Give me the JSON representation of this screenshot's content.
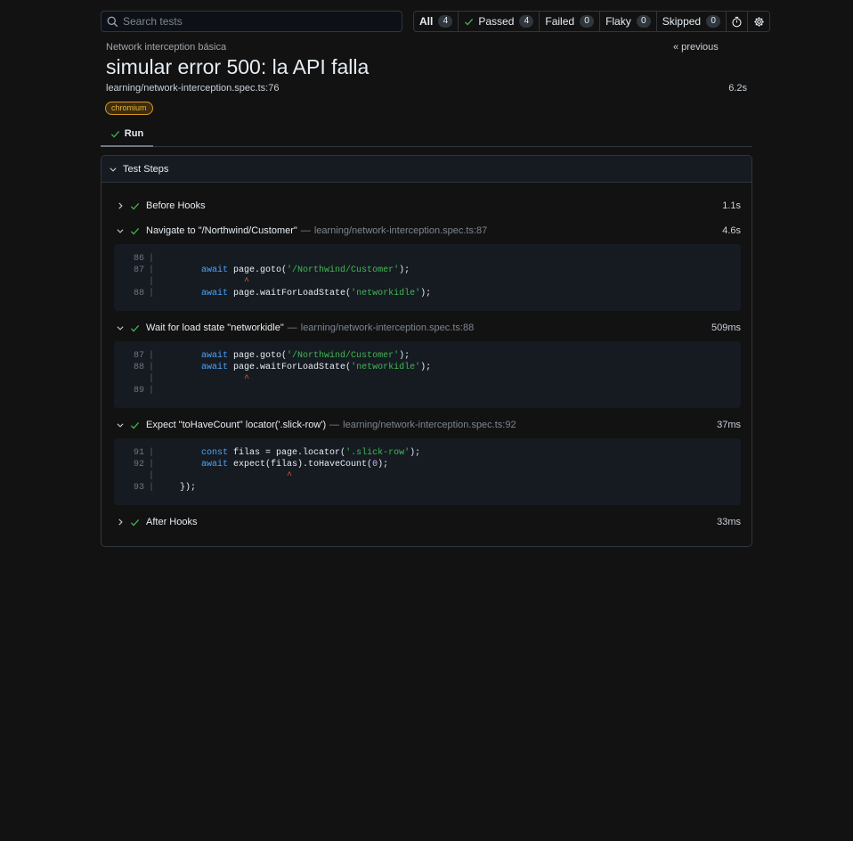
{
  "search": {
    "placeholder": "Search tests"
  },
  "filters": [
    {
      "label": "All",
      "count": "4"
    },
    {
      "label": "Passed",
      "count": "4"
    },
    {
      "label": "Failed",
      "count": "0"
    },
    {
      "label": "Flaky",
      "count": "0"
    },
    {
      "label": "Skipped",
      "count": "0"
    }
  ],
  "header": {
    "breadcrumb": "Network interception básica",
    "previous": "« previous",
    "title": "simular error 500: la API falla",
    "location": "learning/network-interception.spec.ts:76",
    "duration": "6.2s",
    "project": "chromium"
  },
  "tabs": [
    {
      "label": "Run"
    }
  ],
  "test_steps": {
    "title": "Test Steps",
    "steps": [
      {
        "label": "Before Hooks",
        "time": "1.1s"
      },
      {
        "label": "Navigate to \"/Northwind/Customer\"",
        "sep": "—",
        "source": "learning/network-interception.spec.ts:87",
        "time": "4.6s"
      },
      {
        "label": "Wait for load state \"networkidle\"",
        "sep": "—",
        "source": "learning/network-interception.spec.ts:88",
        "time": "509ms"
      },
      {
        "label": "Expect \"toHaveCount\" locator('.slick-row')",
        "sep": "—",
        "source": "learning/network-interception.spec.ts:92",
        "time": "37ms"
      },
      {
        "label": "After Hooks",
        "time": "33ms"
      }
    ]
  },
  "code": {
    "n86": "86",
    "n87": "87",
    "n88": "88",
    "n89": "89",
    "n91": "91",
    "n92": "92",
    "n93": "93",
    "await": "await",
    "const": "const",
    "goto_call": " page.goto(",
    "goto_arg": "'/Northwind/Customer'",
    "wait_call": " page.waitForLoadState(",
    "wait_arg": "'networkidle'",
    "close": ");",
    "filas_decl": " filas = page.locator(",
    "filas_arg": "'.slick-row'",
    "expect_call": " expect(filas).toHaveCount(",
    "zero": "0",
    "caret": "^",
    "end": "});",
    "pipe": "|"
  },
  "colors": {
    "accent_green": "#3fb950",
    "badge_orange": "#d29922",
    "bg": "#121212"
  },
  "icons": [
    "search-icon",
    "check-icon",
    "stopwatch-icon",
    "gear-icon",
    "chevron-right-icon",
    "chevron-down-icon"
  ]
}
